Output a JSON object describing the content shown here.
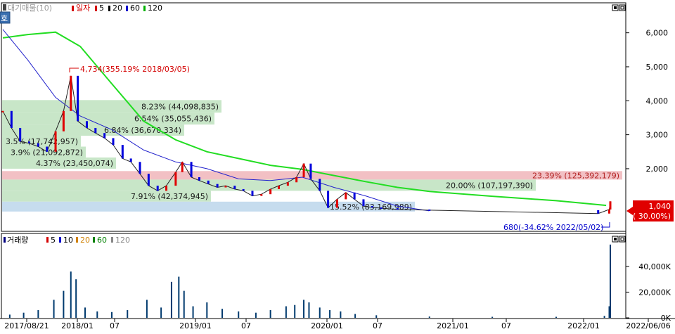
{
  "price_panel": {
    "legend_items": [
      {
        "text": "대기매물(10)",
        "color": "#9a9a9a"
      },
      {
        "text": "일자",
        "color": "#d40000"
      },
      {
        "text": "5",
        "color": "#d40000"
      },
      {
        "text": "20",
        "color": "#000000"
      },
      {
        "text": "60",
        "color": "#0000cc"
      },
      {
        "text": "120",
        "color": "#00b000"
      }
    ],
    "side_button": "호",
    "current_price_label": "1,040",
    "current_change_label": "( 30.00%)",
    "high_annotation": "4,734(355.19% 2018/03/05)",
    "low_annotation": "680(-34.62% 2022/05/02)"
  },
  "volume_panel": {
    "legend_items": [
      {
        "text": "거래량",
        "color": "#000080"
      },
      {
        "text": "5",
        "color": "#d40000"
      },
      {
        "text": "10",
        "color": "#0000cc"
      },
      {
        "text": "20",
        "color": "#d08000"
      },
      {
        "text": "60",
        "color": "#008000"
      },
      {
        "text": "120",
        "color": "#888888"
      }
    ]
  },
  "date_axis_labels": [
    "2017/08/21",
    "2018/01",
    "07",
    "2019/01",
    "07",
    "2020/01",
    "07",
    "2021/01",
    "07",
    "2022/01",
    "2022/06/06"
  ],
  "chart_data": {
    "type": "candlestick",
    "price_y_ticks": [
      {
        "value": 2000,
        "label": "2,000"
      },
      {
        "value": 3000,
        "label": "3,000"
      },
      {
        "value": 4000,
        "label": "4,000"
      },
      {
        "value": 5000,
        "label": "5,000"
      },
      {
        "value": 6000,
        "label": "6,000"
      }
    ],
    "price_ylim": [
      550,
      6800
    ],
    "volume_y_ticks": [
      {
        "value": 0,
        "label": "0K"
      },
      {
        "value": 20000,
        "label": "20,000K"
      },
      {
        "value": 40000,
        "label": "40,000K"
      }
    ],
    "volume_ylim": [
      0,
      58000
    ],
    "volume_profile_bands": [
      {
        "low": 3650,
        "high": 4020,
        "label": "8.23% (44,098,835)",
        "color": "#c8e6c8"
      },
      {
        "low": 3300,
        "high": 3650,
        "label": "6.54% (35,055,436)",
        "color": "#c8e6c8"
      },
      {
        "low": 2970,
        "high": 3300,
        "label": "6.84% (36,670,334)",
        "color": "#c8e6c8"
      },
      {
        "low": 2650,
        "high": 2970,
        "label": "3.5% (17,742,957)",
        "color": "#c8e6c8"
      },
      {
        "low": 2330,
        "high": 2650,
        "label": "3.9% (21,092,872)",
        "color": "#c8e6c8"
      },
      {
        "low": 2000,
        "high": 2330,
        "label": "4.37% (23,450,074)",
        "color": "#c8e6c8"
      },
      {
        "low": 1680,
        "high": 1930,
        "label": "23.39% (125,392,179)",
        "color": "#f2c0c4"
      },
      {
        "low": 1350,
        "high": 1680,
        "label": "20.00% (107,197,390)",
        "color": "#c8e6c8"
      },
      {
        "low": 1030,
        "high": 1350,
        "label": "7.91% (42,374,945)",
        "color": "#c8e6c8"
      },
      {
        "low": 740,
        "high": 1030,
        "label": "15.52% (83,169,989)",
        "color": "#c6dcee"
      }
    ],
    "ma120_line": [
      {
        "date": "2017/08/21",
        "value": 5850
      },
      {
        "date": "2017/11/01",
        "value": 5950
      },
      {
        "date": "2018/01/20",
        "value": 6020
      },
      {
        "date": "2018/04/01",
        "value": 5600
      },
      {
        "date": "2018/07/01",
        "value": 4500
      },
      {
        "date": "2018/10/01",
        "value": 3400
      },
      {
        "date": "2019/01/01",
        "value": 2850
      },
      {
        "date": "2019/04/01",
        "value": 2500
      },
      {
        "date": "2019/07/01",
        "value": 2300
      },
      {
        "date": "2019/10/01",
        "value": 2100
      },
      {
        "date": "2020/01/01",
        "value": 1980
      },
      {
        "date": "2020/04/01",
        "value": 1800
      },
      {
        "date": "2020/07/01",
        "value": 1620
      },
      {
        "date": "2020/10/01",
        "value": 1450
      },
      {
        "date": "2021/01/01",
        "value": 1330
      },
      {
        "date": "2021/07/01",
        "value": 1190
      },
      {
        "date": "2022/01/01",
        "value": 1060
      },
      {
        "date": "2022/05/25",
        "value": 920
      }
    ],
    "ma60_line": [
      {
        "date": "2017/08/21",
        "value": 6100
      },
      {
        "date": "2017/11/01",
        "value": 5200
      },
      {
        "date": "2018/01/20",
        "value": 4100
      },
      {
        "date": "2018/04/01",
        "value": 3550
      },
      {
        "date": "2018/07/01",
        "value": 3150
      },
      {
        "date": "2018/10/01",
        "value": 2550
      },
      {
        "date": "2019/01/01",
        "value": 2200
      },
      {
        "date": "2019/04/01",
        "value": 2000
      },
      {
        "date": "2019/07/01",
        "value": 1700
      },
      {
        "date": "2019/10/01",
        "value": 1650
      },
      {
        "date": "2020/01/01",
        "value": 1750
      },
      {
        "date": "2020/04/01",
        "value": 1450
      },
      {
        "date": "2020/07/01",
        "value": 1200
      },
      {
        "date": "2020/10/01",
        "value": 900
      },
      {
        "date": "2020/12/31",
        "value": 760
      }
    ],
    "price_series": [
      {
        "date": "2017/08/21",
        "value": 3700
      },
      {
        "date": "2017/09/15",
        "value": 3200
      },
      {
        "date": "2017/10/10",
        "value": 2800
      },
      {
        "date": "2017/11/05",
        "value": 2750
      },
      {
        "date": "2017/12/01",
        "value": 2650
      },
      {
        "date": "2017/12/26",
        "value": 2500
      },
      {
        "date": "2018/01/20",
        "value": 3100
      },
      {
        "date": "2018/02/12",
        "value": 3700
      },
      {
        "date": "2018/03/05",
        "value": 4734
      },
      {
        "date": "2018/03/25",
        "value": 3400
      },
      {
        "date": "2018/04/20",
        "value": 3200
      },
      {
        "date": "2018/05/15",
        "value": 3050
      },
      {
        "date": "2018/06/10",
        "value": 2900
      },
      {
        "date": "2018/07/05",
        "value": 2700
      },
      {
        "date": "2018/08/01",
        "value": 2300
      },
      {
        "date": "2018/08/25",
        "value": 2200
      },
      {
        "date": "2018/09/20",
        "value": 1850
      },
      {
        "date": "2018/10/15",
        "value": 1500
      },
      {
        "date": "2018/11/10",
        "value": 1350
      },
      {
        "date": "2018/12/05",
        "value": 1500
      },
      {
        "date": "2019/01/01",
        "value": 1900
      },
      {
        "date": "2019/01/20",
        "value": 2200
      },
      {
        "date": "2019/02/15",
        "value": 1750
      },
      {
        "date": "2019/03/10",
        "value": 1650
      },
      {
        "date": "2019/04/05",
        "value": 1550
      },
      {
        "date": "2019/05/01",
        "value": 1450
      },
      {
        "date": "2019/05/25",
        "value": 1500
      },
      {
        "date": "2019/06/20",
        "value": 1400
      },
      {
        "date": "2019/07/15",
        "value": 1350
      },
      {
        "date": "2019/08/10",
        "value": 1200
      },
      {
        "date": "2019/09/05",
        "value": 1250
      },
      {
        "date": "2019/10/01",
        "value": 1400
      },
      {
        "date": "2019/10/25",
        "value": 1500
      },
      {
        "date": "2019/11/20",
        "value": 1600
      },
      {
        "date": "2019/12/15",
        "value": 1750
      },
      {
        "date": "2020/01/05",
        "value": 2150
      },
      {
        "date": "2020/01/25",
        "value": 1700
      },
      {
        "date": "2020/02/20",
        "value": 1350
      },
      {
        "date": "2020/03/15",
        "value": 850
      },
      {
        "date": "2020/04/10",
        "value": 1100
      },
      {
        "date": "2020/05/05",
        "value": 1300
      },
      {
        "date": "2020/05/30",
        "value": 1100
      },
      {
        "date": "2020/06/25",
        "value": 900
      },
      {
        "date": "2020/07/20",
        "value": 860
      },
      {
        "date": "2020/08/15",
        "value": 840
      },
      {
        "date": "2020/10/01",
        "value": 800
      },
      {
        "date": "2021/01/01",
        "value": 780
      },
      {
        "date": "2022/05/02",
        "value": 680
      },
      {
        "date": "2022/06/03",
        "value": 800
      },
      {
        "date": "2022/06/06",
        "value": 1040
      }
    ],
    "volume_series": [
      {
        "date": "2017/09/10",
        "value": 2500
      },
      {
        "date": "2017/10/20",
        "value": 4000
      },
      {
        "date": "2017/12/01",
        "value": 6000
      },
      {
        "date": "2018/01/15",
        "value": 14000
      },
      {
        "date": "2018/02/12",
        "value": 21000
      },
      {
        "date": "2018/03/05",
        "value": 36000
      },
      {
        "date": "2018/03/20",
        "value": 30000
      },
      {
        "date": "2018/04/15",
        "value": 8000
      },
      {
        "date": "2018/05/20",
        "value": 5000
      },
      {
        "date": "2018/07/01",
        "value": 4500
      },
      {
        "date": "2018/08/15",
        "value": 6000
      },
      {
        "date": "2018/10/10",
        "value": 14000
      },
      {
        "date": "2018/11/20",
        "value": 8000
      },
      {
        "date": "2018/12/20",
        "value": 28000
      },
      {
        "date": "2019/01/10",
        "value": 32000
      },
      {
        "date": "2019/01/25",
        "value": 21000
      },
      {
        "date": "2019/02/20",
        "value": 9000
      },
      {
        "date": "2019/04/01",
        "value": 12000
      },
      {
        "date": "2019/05/15",
        "value": 7000
      },
      {
        "date": "2019/07/01",
        "value": 5000
      },
      {
        "date": "2019/08/20",
        "value": 4000
      },
      {
        "date": "2019/10/01",
        "value": 6000
      },
      {
        "date": "2019/11/15",
        "value": 9000
      },
      {
        "date": "2019/12/10",
        "value": 10000
      },
      {
        "date": "2020/01/05",
        "value": 14000
      },
      {
        "date": "2020/01/20",
        "value": 12000
      },
      {
        "date": "2020/02/20",
        "value": 8000
      },
      {
        "date": "2020/03/20",
        "value": 6000
      },
      {
        "date": "2020/04/20",
        "value": 5000
      },
      {
        "date": "2020/06/01",
        "value": 3000
      },
      {
        "date": "2020/08/01",
        "value": 2000
      },
      {
        "date": "2021/01/01",
        "value": 1000
      },
      {
        "date": "2021/07/01",
        "value": 800
      },
      {
        "date": "2022/01/01",
        "value": 800
      },
      {
        "date": "2022/05/20",
        "value": 1500
      },
      {
        "date": "2022/06/03",
        "value": 9000
      },
      {
        "date": "2022/06/06",
        "value": 57000
      }
    ]
  }
}
